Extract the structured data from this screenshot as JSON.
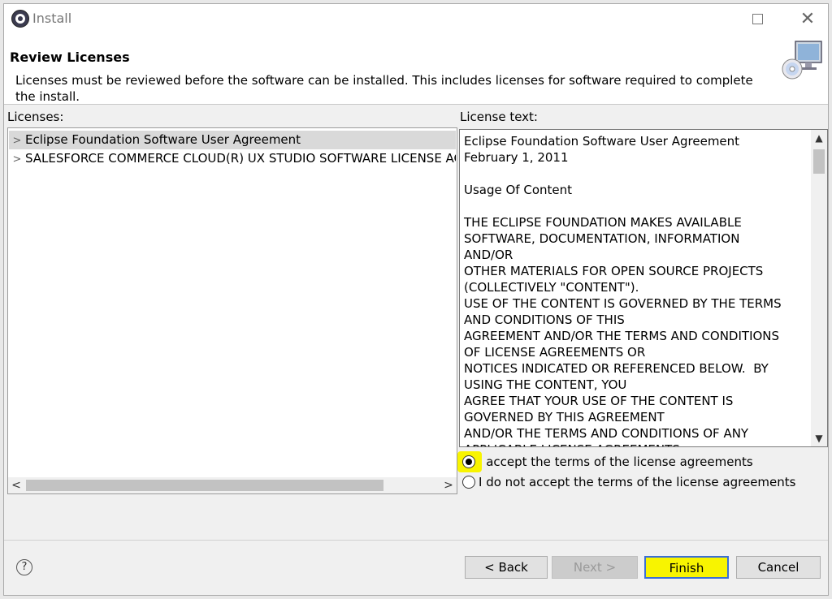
{
  "window": {
    "title": "Install"
  },
  "header": {
    "title": "Review Licenses",
    "description": "Licenses must be reviewed before the software can be installed.  This includes licenses for software required to complete the install."
  },
  "licenses": {
    "label": "Licenses:",
    "items": [
      {
        "label": "Eclipse Foundation Software User Agreement",
        "selected": true
      },
      {
        "label": "SALESFORCE COMMERCE CLOUD(R) UX STUDIO SOFTWARE LICENSE AGREEMENT",
        "selected": false
      }
    ]
  },
  "license_text": {
    "label": "License text:",
    "content": "Eclipse Foundation Software User Agreement\nFebruary 1, 2011\n\nUsage Of Content\n\nTHE ECLIPSE FOUNDATION MAKES AVAILABLE\nSOFTWARE, DOCUMENTATION, INFORMATION\nAND/OR\nOTHER MATERIALS FOR OPEN SOURCE PROJECTS\n(COLLECTIVELY \"CONTENT\").\nUSE OF THE CONTENT IS GOVERNED BY THE TERMS\nAND CONDITIONS OF THIS\nAGREEMENT AND/OR THE TERMS AND CONDITIONS\nOF LICENSE AGREEMENTS OR\nNOTICES INDICATED OR REFERENCED BELOW.  BY\nUSING THE CONTENT, YOU\nAGREE THAT YOUR USE OF THE CONTENT IS\nGOVERNED BY THIS AGREEMENT\nAND/OR THE TERMS AND CONDITIONS OF ANY\nAPPLICABLE LICENSE AGREEMENTS"
  },
  "radios": {
    "accept": {
      "label": "I accept the terms of the license agreements",
      "checked": true
    },
    "decline": {
      "label": "I do not accept the terms of the license agreements",
      "checked": false
    }
  },
  "buttons": {
    "help": "?",
    "back": "< Back",
    "next": "Next >",
    "finish": "Finish",
    "cancel": "Cancel"
  },
  "icons": {
    "app": "eclipse-icon",
    "maximize": "maximize-icon",
    "close": "close-icon",
    "header_image": "install-cd-computer-icon",
    "help": "help-icon"
  },
  "colors": {
    "highlight": "#f8f400",
    "focus_border": "#3b6fd4"
  }
}
